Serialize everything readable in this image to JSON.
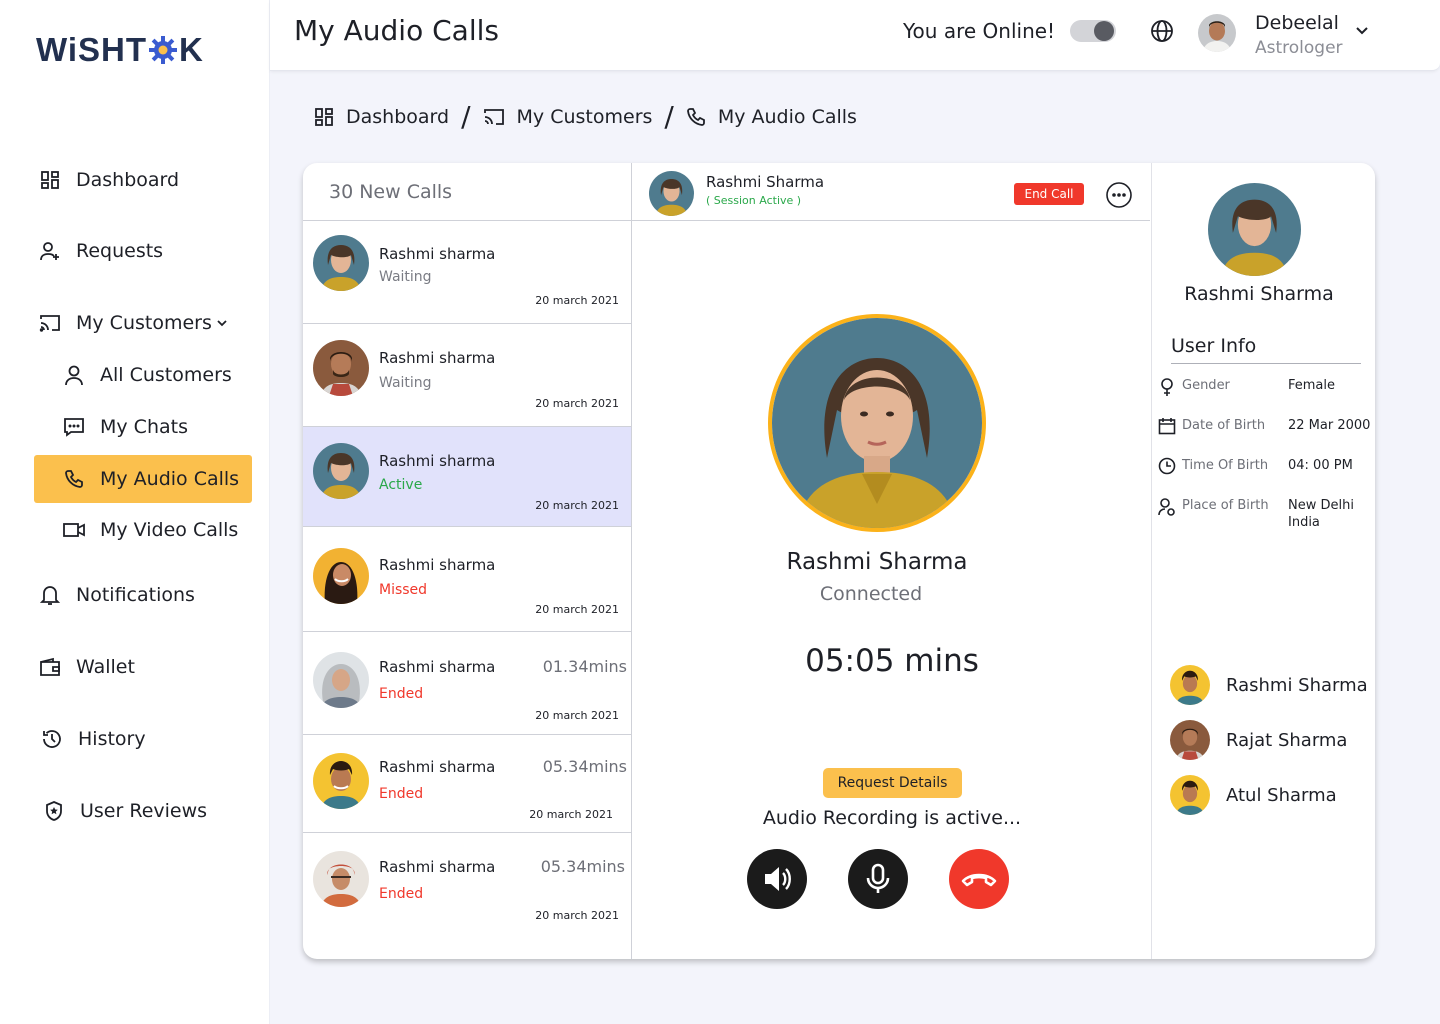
{
  "brand": {
    "logo_left": "WiSHT",
    "logo_right": "K"
  },
  "sidebar": {
    "items": [
      {
        "label": "Dashboard",
        "icon": "dashboard-icon"
      },
      {
        "label": "Requests",
        "icon": "user-add-icon"
      },
      {
        "label": "My Customers",
        "icon": "cast-icon"
      },
      {
        "label": "All Customers",
        "icon": "user-icon"
      },
      {
        "label": "My Chats",
        "icon": "chat-icon"
      },
      {
        "label": "My Audio Calls",
        "icon": "phone-icon"
      },
      {
        "label": "My Video Calls",
        "icon": "video-icon"
      },
      {
        "label": "Notifications",
        "icon": "bell-icon"
      },
      {
        "label": "Wallet",
        "icon": "wallet-icon"
      },
      {
        "label": "History",
        "icon": "history-icon"
      },
      {
        "label": "User Reviews",
        "icon": "shield-star-icon"
      }
    ]
  },
  "header": {
    "title": "My Audio Calls",
    "online_text": "You are Online!",
    "online": true,
    "user_name": "Debeelal",
    "user_role": "Astrologer"
  },
  "breadcrumb": {
    "items": [
      "Dashboard",
      "My Customers",
      "My Audio Calls"
    ],
    "separator": "/"
  },
  "calls": {
    "heading": "30 New Calls",
    "rows": [
      {
        "name": "Rashmi sharma",
        "status": "Waiting",
        "date": "20 march 2021",
        "duration": "",
        "status_color": "#7a7c84"
      },
      {
        "name": "Rashmi sharma",
        "status": "Waiting",
        "date": "20 march 2021",
        "duration": "",
        "status_color": "#7a7c84"
      },
      {
        "name": "Rashmi sharma",
        "status": "Active",
        "date": "20 march 2021",
        "duration": "",
        "status_color": "#2aa84a"
      },
      {
        "name": "Rashmi sharma",
        "status": "Missed",
        "date": "20 march 2021",
        "duration": "",
        "status_color": "#f0382b"
      },
      {
        "name": "Rashmi sharma",
        "status": "Ended",
        "date": "20 march 2021",
        "duration": "01.34mins",
        "status_color": "#f0382b"
      },
      {
        "name": "Rashmi sharma",
        "status": "Ended",
        "date": "20 march 2021",
        "duration": "05.34mins",
        "status_color": "#f0382b"
      },
      {
        "name": "Rashmi sharma",
        "status": "Ended",
        "date": "20 march 2021",
        "duration": "05.34mins",
        "status_color": "#f0382b"
      }
    ]
  },
  "session": {
    "name": "Rashmi Sharma",
    "status": "( Session Active )",
    "end_label": "End Call",
    "big_name": "Rashmi Sharma",
    "call_status": "Connected",
    "timer": "05:05 mins",
    "request_label": "Request Details",
    "recording": "Audio Recording is active..."
  },
  "profile": {
    "name": "Rashmi Sharma",
    "section": "User Info",
    "info": [
      {
        "label": "Gender",
        "value": "Female",
        "icon": "gender-female-icon"
      },
      {
        "label": "Date of Birth",
        "value": "22 Mar 2000",
        "icon": "calendar-icon"
      },
      {
        "label": "Time Of Birth",
        "value": "04: 00 PM",
        "icon": "clock-icon"
      },
      {
        "label": "Place of Birth",
        "value": "New Delhi India",
        "icon": "location-user-icon"
      }
    ]
  },
  "contacts": [
    {
      "name": "Rashmi Sharma"
    },
    {
      "name": "Rajat Sharma"
    },
    {
      "name": "Atul Sharma"
    }
  ],
  "colors": {
    "accent": "#fbc04d",
    "danger": "#f0382b",
    "success": "#2aa84a",
    "selected_row": "#e1e2fb",
    "ring": "#fbb21a"
  }
}
